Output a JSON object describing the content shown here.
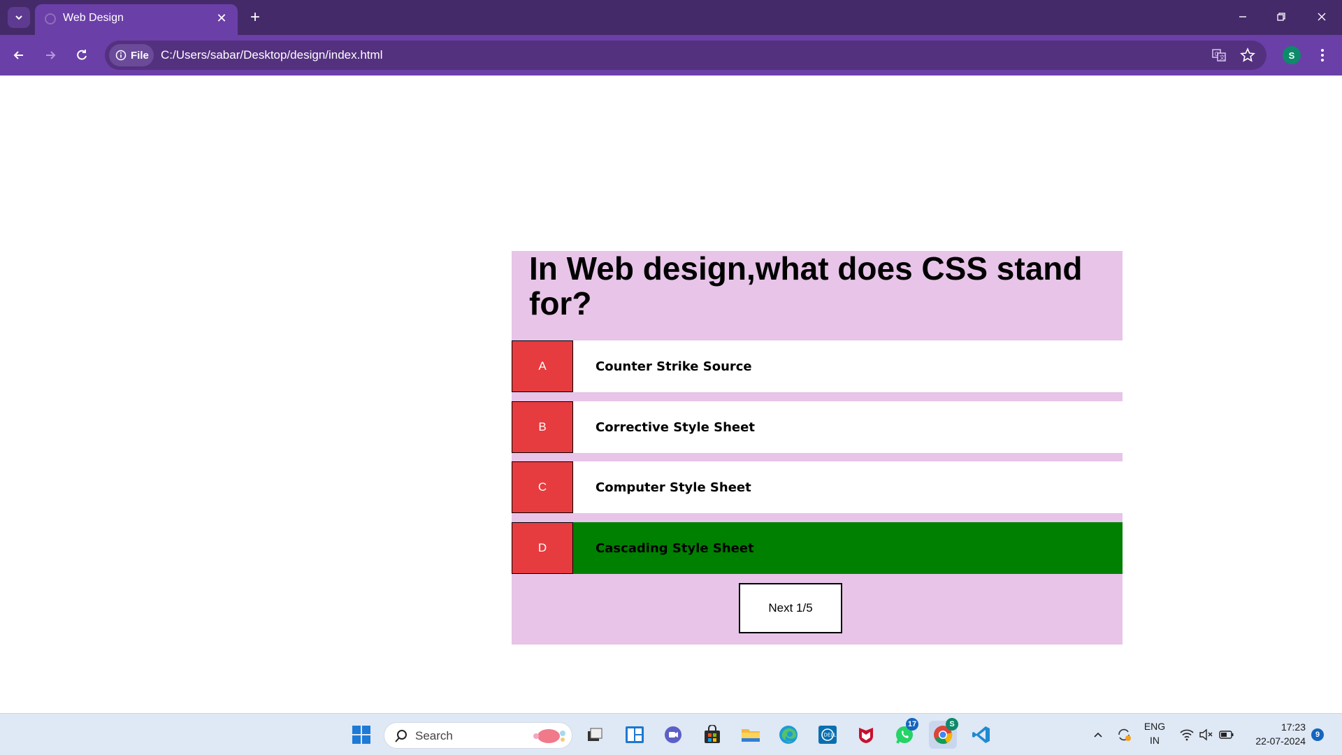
{
  "browser": {
    "tab_title": "Web Design",
    "file_chip_label": "File",
    "url": "C:/Users/sabar/Desktop/design/index.html",
    "profile_initial": "S"
  },
  "quiz": {
    "question": "In Web design,what does CSS stand for?",
    "answers": [
      {
        "letter": "A",
        "text": "Counter Strike Source",
        "selected_correct": false
      },
      {
        "letter": "B",
        "text": "Corrective Style Sheet",
        "selected_correct": false
      },
      {
        "letter": "C",
        "text": "Computer Style Sheet",
        "selected_correct": false
      },
      {
        "letter": "D",
        "text": "Cascading Style Sheet",
        "selected_correct": true
      }
    ],
    "next_label": "Next 1/5"
  },
  "taskbar": {
    "search_label": "Search",
    "whatsapp_badge": "17",
    "chrome_badge": "S",
    "language_line1": "ENG",
    "language_line2": "IN",
    "time": "17:23",
    "date": "22-07-2024",
    "notification_count": "9"
  },
  "colors": {
    "tabstrip": "#452a6a",
    "toolbar": "#6b3fa8",
    "quiz_background": "#e7c4e8",
    "letter_box": "#e63c3f",
    "correct_answer": "#008000"
  }
}
